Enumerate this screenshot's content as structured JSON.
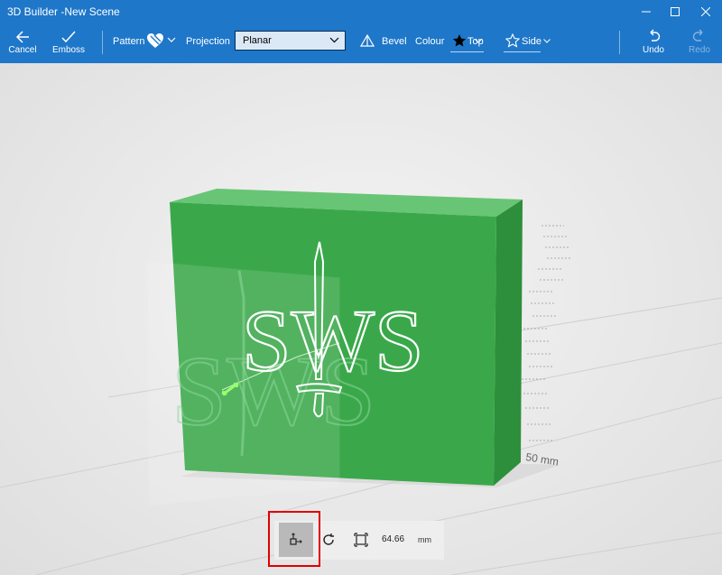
{
  "window": {
    "title": "3D Builder -New Scene"
  },
  "toolbar": {
    "cancel_label": "Cancel",
    "emboss_label": "Emboss",
    "pattern_label": "Pattern",
    "projection_label": "Projection",
    "projection_value": "Planar",
    "bevel_label": "Bevel",
    "colour_label": "Colour",
    "top_label": "Top",
    "side_label": "Side",
    "undo_label": "Undo",
    "redo_label": "Redo"
  },
  "scene": {
    "emboss_text": "SWS",
    "ruler_label": "50 mm",
    "box_color": "#3aa84a"
  },
  "bottom": {
    "dimension_value": "64.66",
    "dimension_unit": "mm"
  },
  "colors": {
    "accent": "#1e77c9",
    "highlight": "#e00000"
  }
}
